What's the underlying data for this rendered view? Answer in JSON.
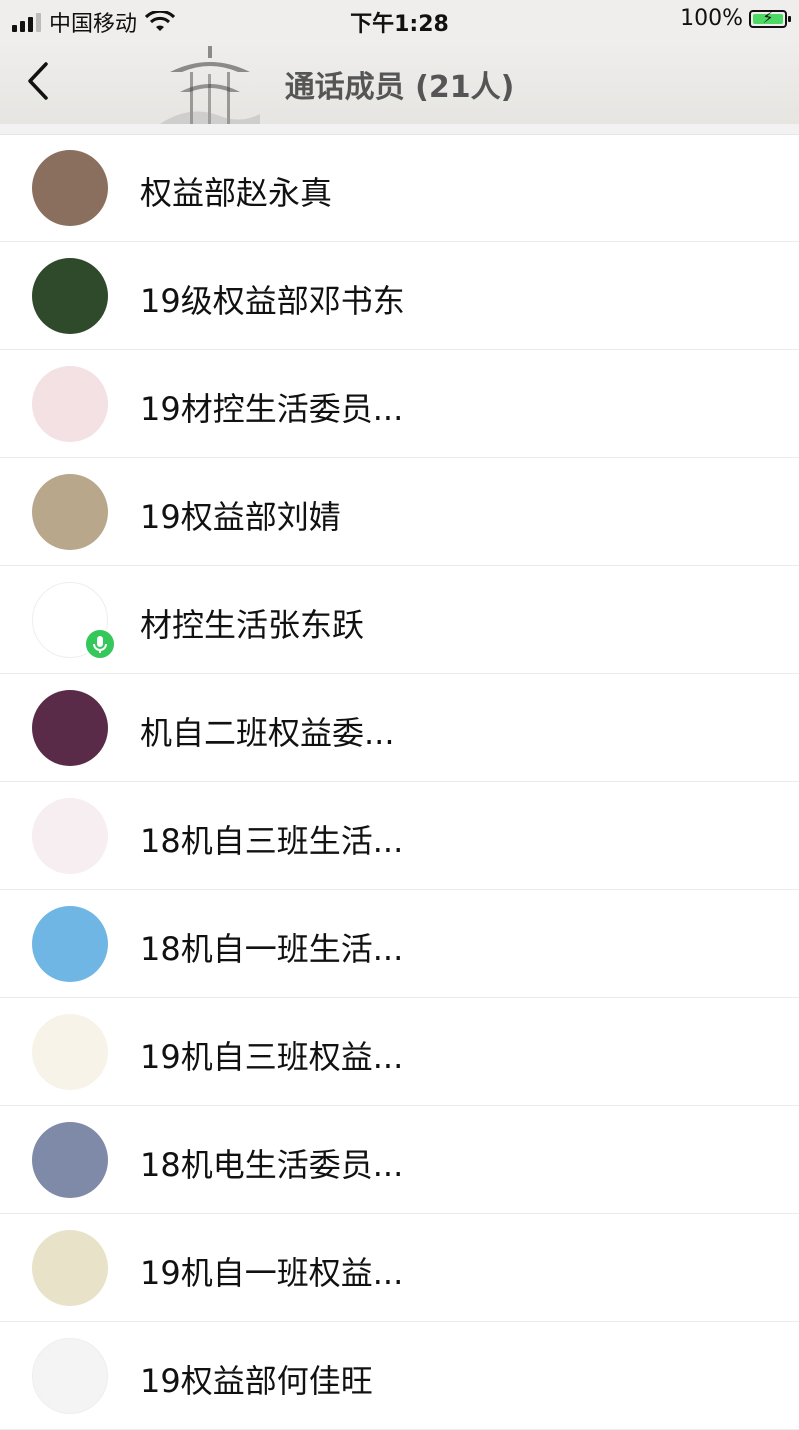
{
  "status_bar": {
    "carrier": "中国移动",
    "time": "下午1:28",
    "battery_percent": "100%"
  },
  "nav": {
    "title": "通话成员 (21人)",
    "back_icon": "chevron-left-icon"
  },
  "members": [
    {
      "name": "权益部赵永真",
      "avatar_color": "#8a6f5e"
    },
    {
      "name": "19级权益部邓书东",
      "avatar_color": "#2f4a2a"
    },
    {
      "name": "19材控生活委员...",
      "avatar_color": "#f3e1e3"
    },
    {
      "name": "19权益部刘婧",
      "avatar_color": "#b9a78c"
    },
    {
      "name": "材控生活张东跃",
      "avatar_color": "#ffffff",
      "speaking": true
    },
    {
      "name": "机自二班权益委...",
      "avatar_color": "#5a2b48"
    },
    {
      "name": "18机自三班生活...",
      "avatar_color": "#f6eef0"
    },
    {
      "name": "18机自一班生活...",
      "avatar_color": "#6fb6e4"
    },
    {
      "name": "19机自三班权益...",
      "avatar_color": "#f7f3e8"
    },
    {
      "name": "18机电生活委员...",
      "avatar_color": "#7f8aa8"
    },
    {
      "name": "19机自一班权益...",
      "avatar_color": "#e7e2c8"
    },
    {
      "name": "19权益部何佳旺",
      "avatar_color": "#f4f4f4"
    }
  ]
}
